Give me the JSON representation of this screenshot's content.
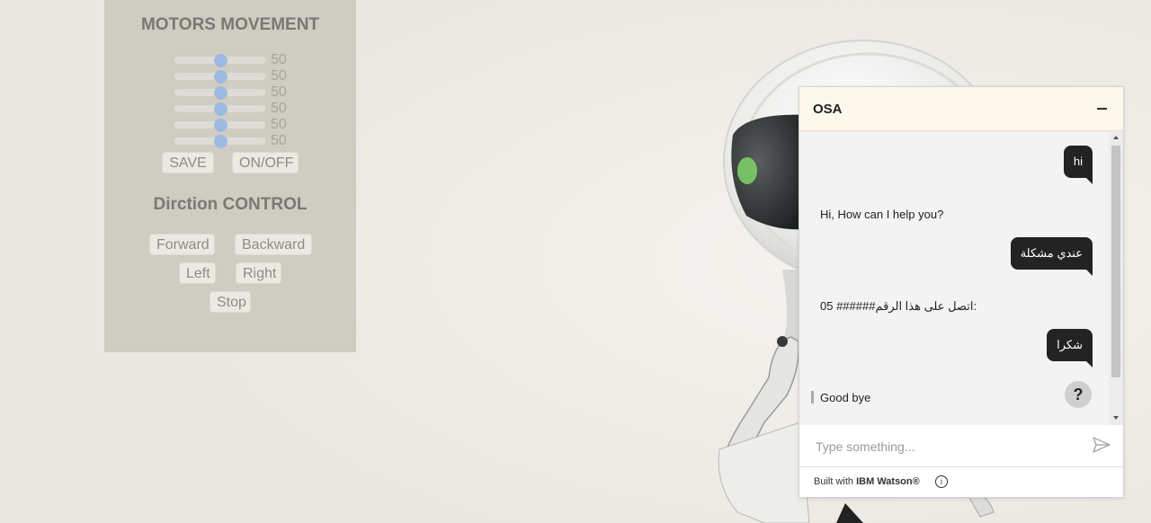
{
  "panel": {
    "motors_title": "MOTORS MOVEMENT",
    "sliders": [
      {
        "value": 50,
        "label": "50"
      },
      {
        "value": 50,
        "label": "50"
      },
      {
        "value": 50,
        "label": "50"
      },
      {
        "value": 50,
        "label": "50"
      },
      {
        "value": 50,
        "label": "50"
      },
      {
        "value": 50,
        "label": "50"
      }
    ],
    "save_label": "SAVE",
    "onoff_label": "ON/OFF",
    "direction_title": "Dirction CONTROL",
    "forward_label": "Forward",
    "backward_label": "Backward",
    "left_label": "Left",
    "right_label": "Right",
    "stop_label": "Stop"
  },
  "chat": {
    "title": "OSA",
    "messages": [
      {
        "from": "user",
        "text": "hi"
      },
      {
        "from": "bot",
        "text": "Hi, How can I help you?"
      },
      {
        "from": "user",
        "text": "عندي مشكلة"
      },
      {
        "from": "bot",
        "text": "05 ######اتصل على هذا الرقم:"
      },
      {
        "from": "user",
        "text": "شكرا"
      },
      {
        "from": "bot",
        "text": "Good bye"
      }
    ],
    "help_symbol": "?",
    "input_placeholder": "Type something...",
    "footer_prefix": "Built with",
    "footer_brand": "IBM Watson®",
    "info_symbol": "i"
  },
  "icons": {
    "minimize": "minimize-icon",
    "send": "send-icon",
    "info": "info-icon",
    "help": "help-icon"
  }
}
